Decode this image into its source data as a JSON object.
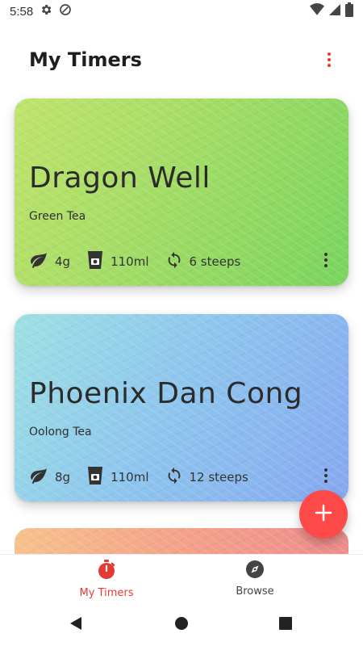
{
  "status_bar": {
    "time": "5:58",
    "icons": [
      "gear-icon",
      "vpn-icon",
      "wifi-icon",
      "signal-icon",
      "battery-icon"
    ]
  },
  "header": {
    "title": "My Timers",
    "menu_icon": "more-vert-icon",
    "accent_color": "#e53935"
  },
  "timers": [
    {
      "name": "Dragon Well",
      "type": "Green Tea",
      "amount": "4g",
      "volume": "110ml",
      "steeps": "6 steeps",
      "colors": [
        "#bfe46c",
        "#79d55e"
      ]
    },
    {
      "name": "Phoenix Dan Cong",
      "type": "Oolong Tea",
      "amount": "8g",
      "volume": "110ml",
      "steeps": "12 steeps",
      "colors": [
        "#9ee1e3",
        "#86a9f0"
      ]
    },
    {
      "name": "",
      "type": "",
      "colors": [
        "#f7c28d",
        "#ef8d8d"
      ]
    }
  ],
  "fab": {
    "icon": "plus-icon",
    "color": "#ff4a4a"
  },
  "bottom_nav": {
    "items": [
      {
        "label": "My Timers",
        "icon": "stopwatch-icon",
        "active": true
      },
      {
        "label": "Browse",
        "icon": "compass-icon",
        "active": false
      }
    ]
  },
  "system_nav": [
    "back-icon",
    "home-icon",
    "recents-icon"
  ]
}
